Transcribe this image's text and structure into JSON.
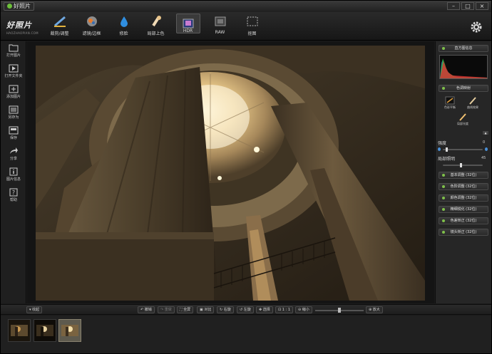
{
  "window": {
    "title": "好照片",
    "minimize": "–",
    "maximize": "□",
    "close": "×"
  },
  "brand": {
    "name": "好照片",
    "sub": "HAOZHAOPIAN.COM"
  },
  "toolbar": {
    "tools": [
      {
        "label": "裁剪/调整",
        "icon": "crop-adjust-icon"
      },
      {
        "label": "滤镜/边框",
        "icon": "filter-frame-icon"
      },
      {
        "label": "修脸",
        "icon": "drop-icon"
      },
      {
        "label": "局部上色",
        "icon": "brush-color-icon"
      },
      {
        "label": "HDR",
        "icon": "hdr-icon",
        "active": true
      },
      {
        "label": "RAW",
        "icon": "raw-icon"
      },
      {
        "label": "抠图",
        "icon": "cutout-icon"
      }
    ],
    "settings_icon": "gear-icon"
  },
  "sidebar": {
    "items": [
      {
        "label": "打开图片",
        "icon": "folder-icon"
      },
      {
        "label": "打开文件夹",
        "icon": "play-folder-icon"
      },
      {
        "label": "添加图片",
        "icon": "add-image-icon"
      },
      {
        "label": "另存为",
        "icon": "save-as-icon"
      },
      {
        "label": "保存",
        "icon": "hdd-save-icon"
      },
      {
        "label": "分享",
        "icon": "share-icon"
      },
      {
        "label": "图片信息",
        "icon": "info-icon"
      },
      {
        "label": "帮助",
        "icon": "help-icon"
      }
    ]
  },
  "right_panel": {
    "histogram_label": "直方图信息",
    "tone_mapping_label": "色调映射",
    "tone_items": [
      "色彩平衡",
      "曲线效果",
      "局部光度"
    ],
    "strength": {
      "label": "强度",
      "value": "0"
    },
    "local_light": {
      "label": "局部照明",
      "value": "45"
    },
    "sections": [
      "基本调整 (32位)",
      "色阶调整 (32位)",
      "颜色调整 (32位)",
      "精细锐化 (32位)",
      "色差矫正 (32位)",
      "镜头矫正 (32位)"
    ]
  },
  "bottom_bar": {
    "collapse": "▾ 收起",
    "undo": "撤销",
    "redo": "重做",
    "fullscreen": "全屏",
    "compare": "对比",
    "rotate_right": "右旋",
    "rotate_left": "左旋",
    "select": "选择",
    "actual_size": "1 : 1",
    "zoom_out": "缩小",
    "zoom_in": "放大",
    "zoom_level": 0.5
  },
  "filmstrip": {
    "thumbnails": 3,
    "selected_index": 2
  },
  "colors": {
    "accent_green": "#7fc04a",
    "bg": "#1b1b1b"
  }
}
